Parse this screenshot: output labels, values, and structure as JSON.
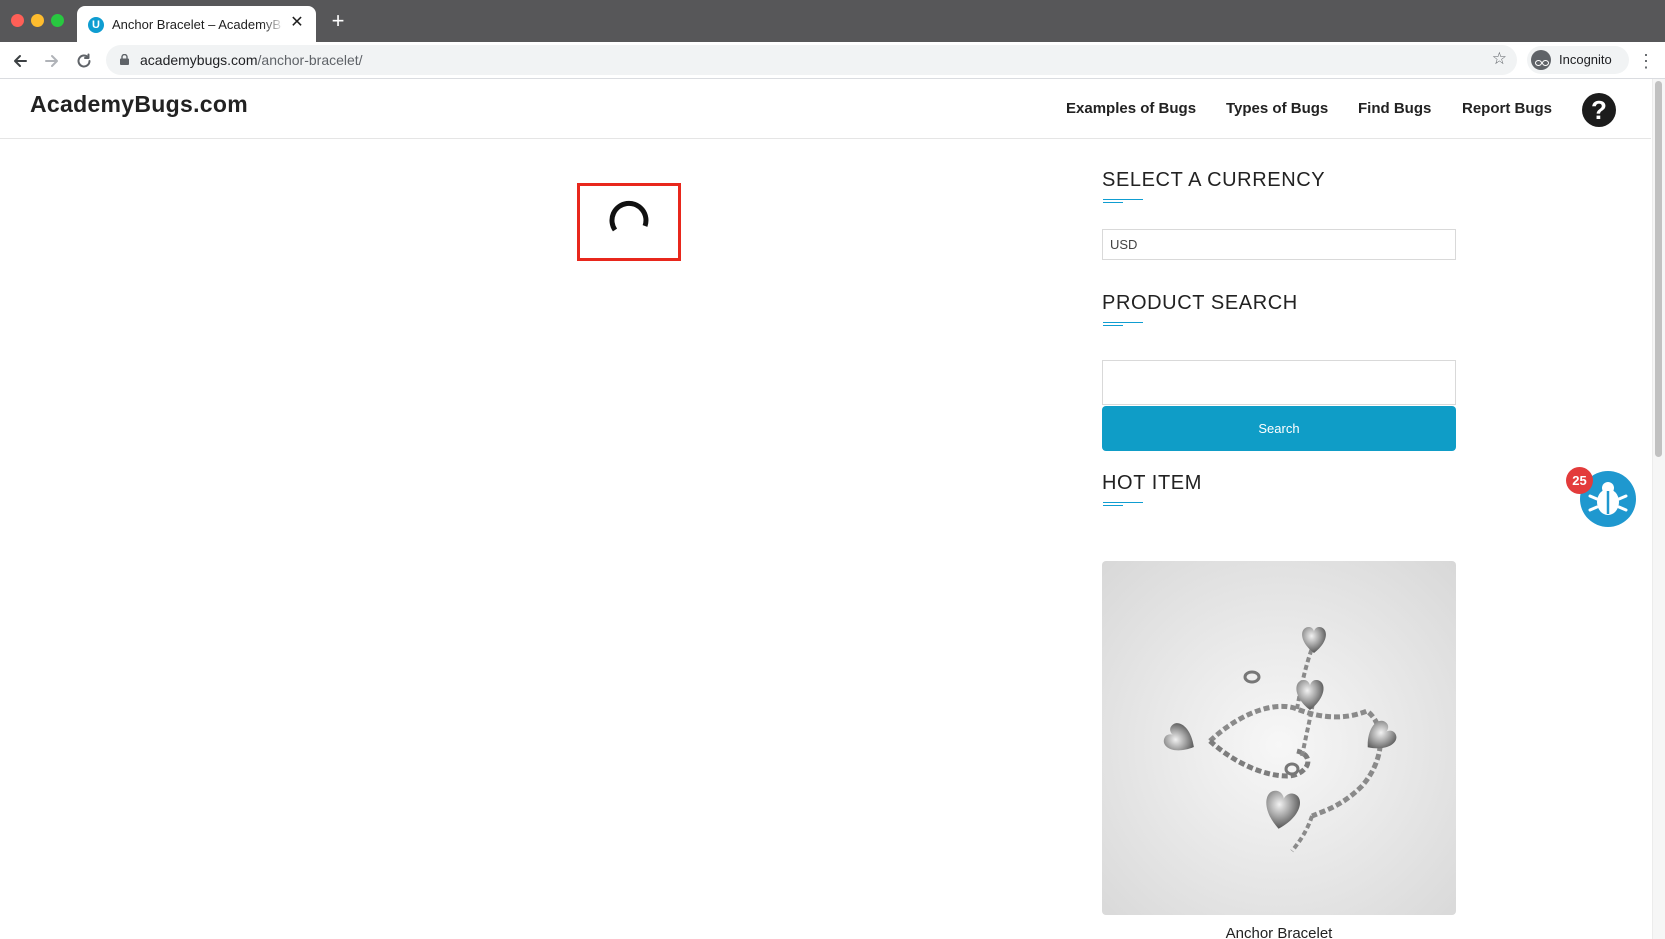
{
  "browser": {
    "tab_title": "Anchor Bracelet – AcademyBugs.com",
    "tab_favicon_letter": "U",
    "url_host": "academybugs.com",
    "url_path": "/anchor-bracelet/",
    "profile_label": "Incognito"
  },
  "site": {
    "logo": "AcademyBugs.com",
    "nav": [
      {
        "label": "Examples of Bugs"
      },
      {
        "label": "Types of Bugs"
      },
      {
        "label": "Find Bugs"
      },
      {
        "label": "Report Bugs"
      }
    ],
    "help_glyph": "?"
  },
  "sidebar": {
    "currency": {
      "title": "SELECT A CURRENCY",
      "selected": "USD"
    },
    "search": {
      "title": "PRODUCT SEARCH",
      "placeholder": "",
      "button_label": "Search"
    },
    "hot_item": {
      "title": "HOT ITEM",
      "product_name": "Anchor Bracelet"
    }
  },
  "bug_widget": {
    "badge_count": "25"
  },
  "colors": {
    "accent": "#0f9dc7",
    "highlight_border": "#e8271c",
    "badge": "#e33b3b"
  }
}
